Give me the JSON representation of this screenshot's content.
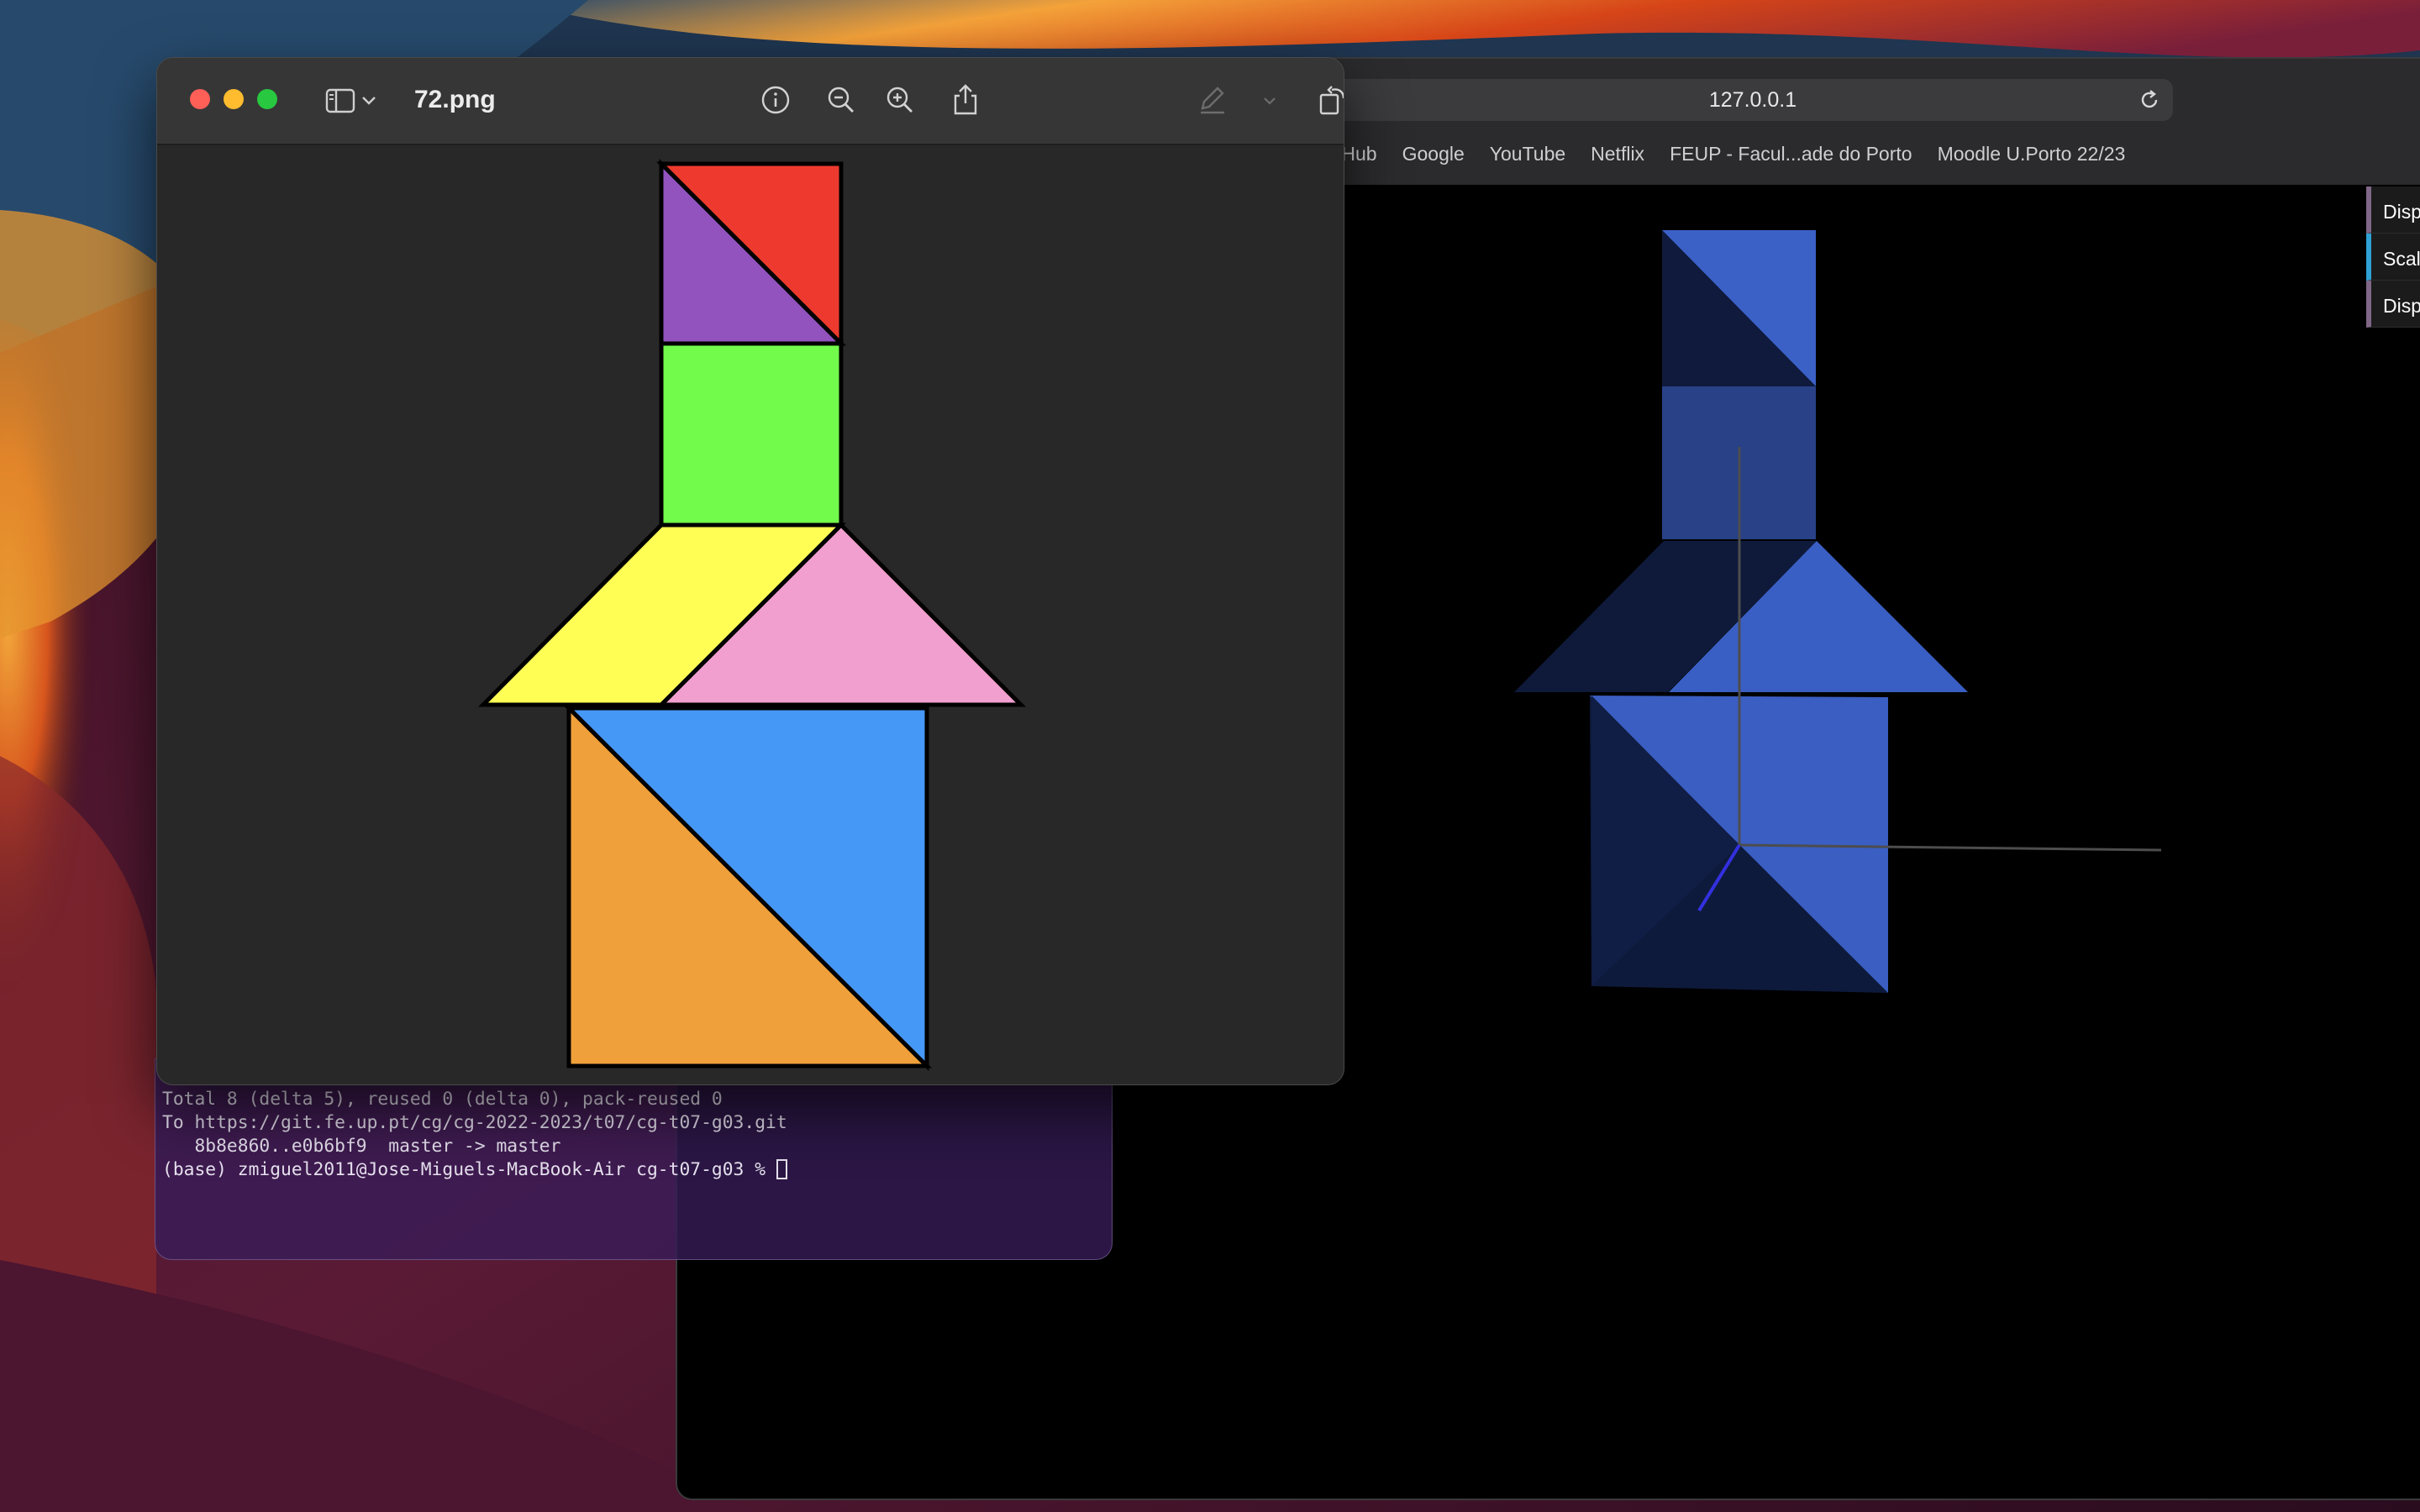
{
  "browser": {
    "address": "127.0.0.1",
    "bookmarks": [
      "tHub",
      "Google",
      "YouTube",
      "Netflix",
      "FEUP - Facul...ade do Porto",
      "Moodle U.Porto 22/23"
    ],
    "gui": [
      {
        "label": "Displ",
        "kind": "checkbox"
      },
      {
        "label": "Scale",
        "kind": "number"
      },
      {
        "label": "Displ",
        "kind": "checkbox"
      }
    ]
  },
  "terminal": {
    "lines": [
      "Total 8 (delta 5), reused 0 (delta 0), pack-reused 0",
      "To https://git.fe.up.pt/cg/cg-2022-2023/t07/cg-t07-g03.git",
      "   8b8e860..e0b6bf9  master -> master",
      "(base) zmiguel2011@Jose-Miguels-MacBook-Air cg-t07-g03 % "
    ]
  },
  "preview": {
    "title": "72.png",
    "toolbar_icons": [
      "sidebar-icon",
      "chevron-down-icon",
      "info-icon",
      "zoom-out-icon",
      "zoom-in-icon",
      "share-icon",
      "markup-pen-icon",
      "rotate-icon",
      "annotate-icon",
      "search-icon"
    ]
  },
  "tangram_colors": {
    "red": "#ee3a2e",
    "purple": "#9253be",
    "green": "#73fb4b",
    "yellow": "#fefe55",
    "pink": "#f09fcf",
    "blue": "#4698f7",
    "orange": "#f0a03b"
  }
}
